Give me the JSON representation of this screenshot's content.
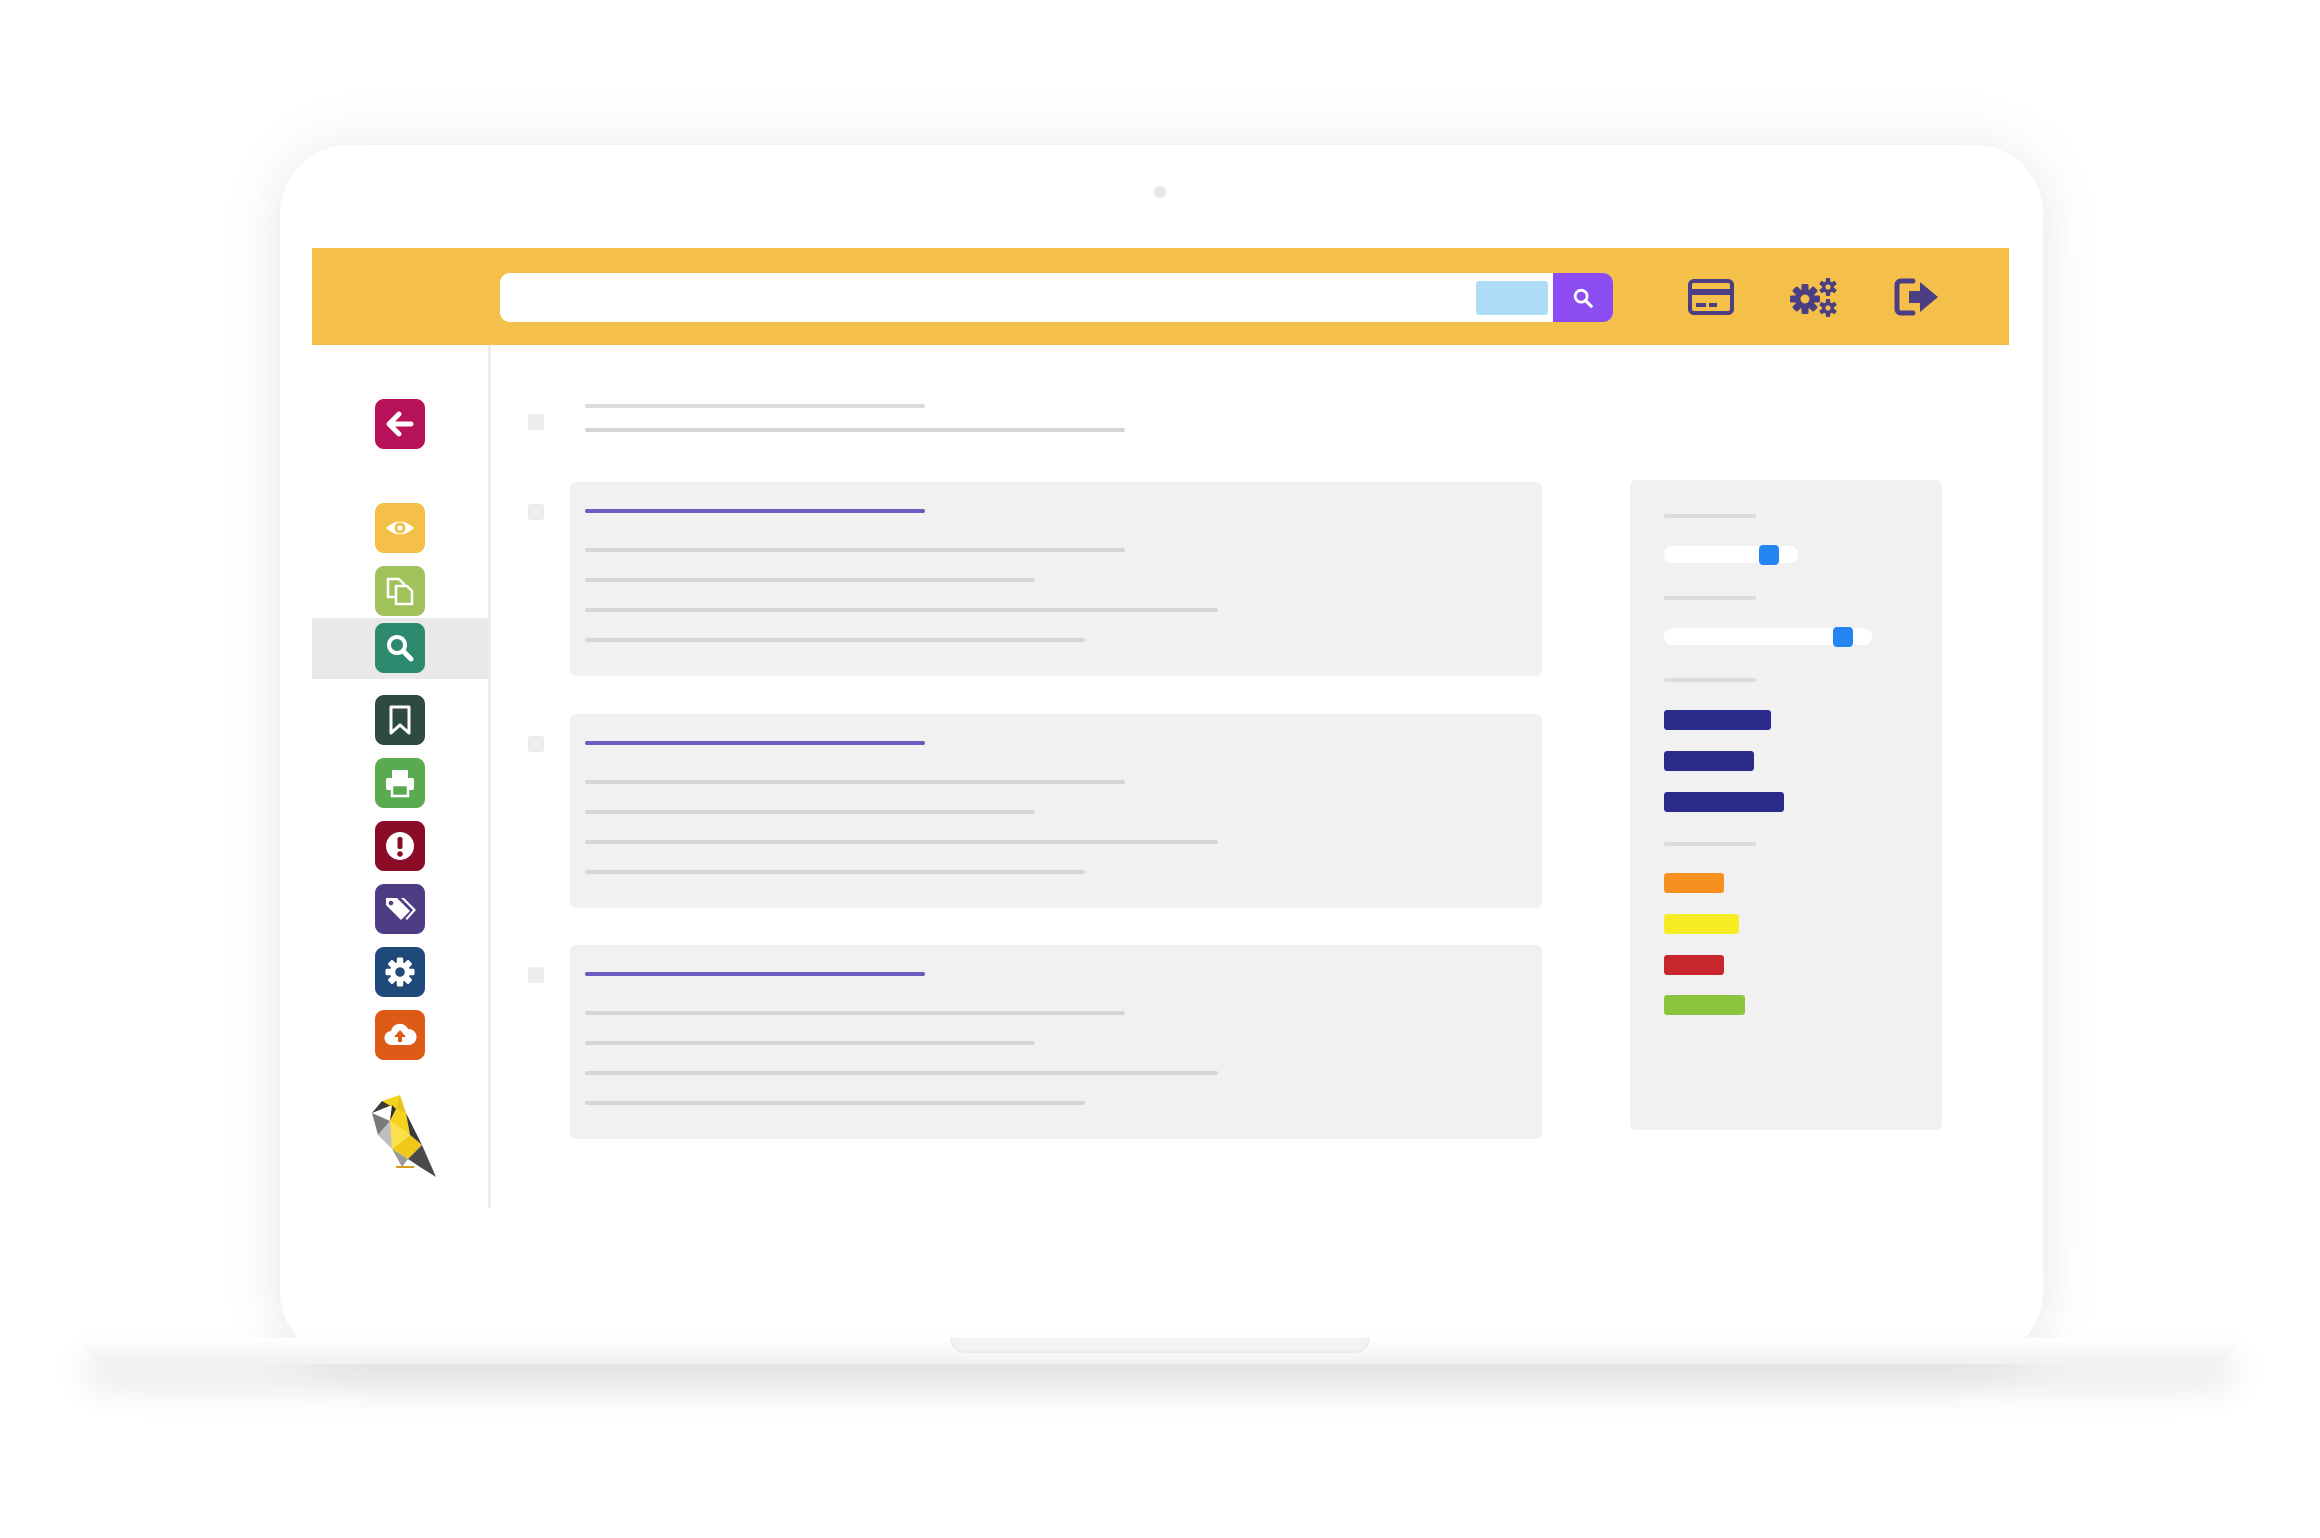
{
  "colors": {
    "topbar": "#f4c04a",
    "search_chip": "#aedcf8",
    "search_button": "#8c4cf2",
    "topbar_icons": "#4b3e82",
    "result_title": "#6c5cbf",
    "slider_knob": "#2585f3"
  },
  "search": {
    "placeholder": "",
    "icon": "search-icon"
  },
  "topbar_icons": [
    {
      "name": "credit-card-icon"
    },
    {
      "name": "cogs-icon"
    },
    {
      "name": "sign-out-icon"
    }
  ],
  "sidebar": {
    "active_index": 3,
    "items": [
      {
        "name": "arrow-left-icon",
        "color": "#b7115a"
      },
      {
        "name": "eye-icon",
        "color": "#f4c04a"
      },
      {
        "name": "copy-files-icon",
        "color": "#9fc25a"
      },
      {
        "name": "search-icon",
        "color": "#2e8a6f"
      },
      {
        "name": "bookmark-icon",
        "color": "#2f4a43"
      },
      {
        "name": "print-icon",
        "color": "#5aaa51"
      },
      {
        "name": "alert-icon",
        "color": "#8a0c26"
      },
      {
        "name": "tags-icon",
        "color": "#4e3d84"
      },
      {
        "name": "gear-icon",
        "color": "#1d4a78"
      },
      {
        "name": "cloud-upload-icon",
        "color": "#dd5a17"
      }
    ],
    "logo": "finch-bird-logo"
  },
  "results": {
    "count": 3
  },
  "facets": {
    "slider_fill": [
      0.78,
      0.86
    ],
    "navy_bars": {
      "color": "#2b2b8b",
      "lengths": [
        107,
        90,
        120
      ]
    },
    "color_bars": [
      {
        "color": "#f7901e",
        "length": 60
      },
      {
        "color": "#f7ec24",
        "length": 75
      },
      {
        "color": "#c8262f",
        "length": 60
      },
      {
        "color": "#8bc43f",
        "length": 81
      }
    ]
  }
}
